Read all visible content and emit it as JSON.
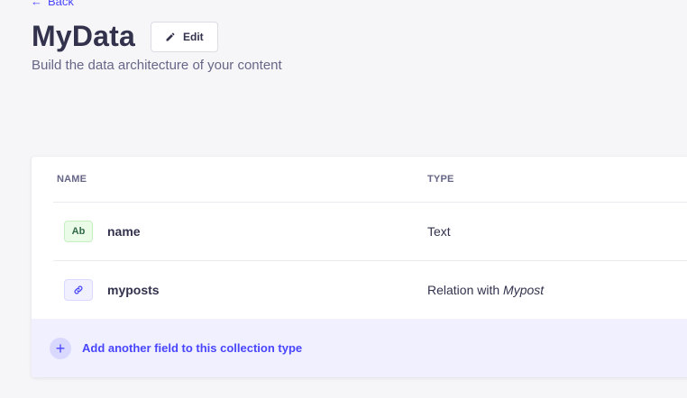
{
  "nav": {
    "back_label": "Back"
  },
  "header": {
    "title": "MyData",
    "edit_label": "Edit",
    "subtitle": "Build the data architecture of your content"
  },
  "table": {
    "columns": {
      "name": "NAME",
      "type": "TYPE"
    },
    "rows": [
      {
        "badge": "Ab",
        "badge_kind": "text",
        "name": "name",
        "type_prefix": "Text",
        "type_target": ""
      },
      {
        "badge": "link-icon",
        "badge_kind": "relation",
        "name": "myposts",
        "type_prefix": "Relation with",
        "type_target": "Mypost"
      }
    ],
    "add_field_label": "Add another field to this collection type"
  },
  "colors": {
    "accent": "#4945ff",
    "accent_light": "#f0f0ff",
    "text_badge_bg": "#eafbe7",
    "text_badge_fg": "#2f6846",
    "page_bg": "#f6f6f9"
  }
}
